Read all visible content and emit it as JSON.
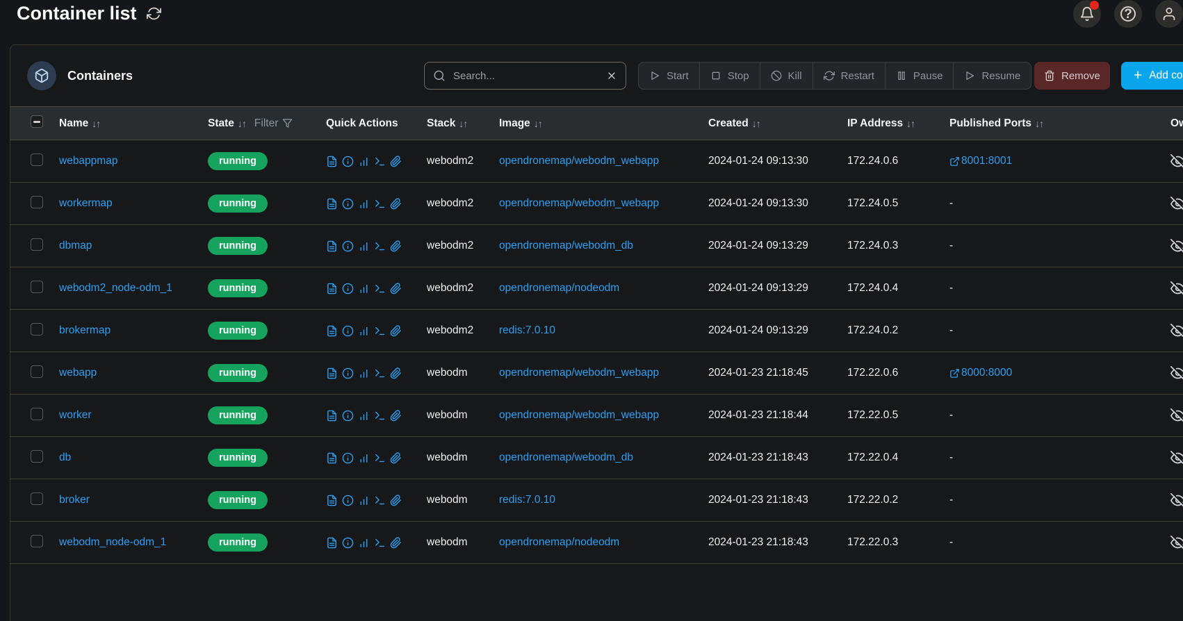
{
  "page_title": "Container list",
  "topbar": {
    "icons": [
      "notifications-bell",
      "help",
      "user"
    ]
  },
  "widget": {
    "title": "Containers",
    "search": {
      "placeholder": "Search..."
    },
    "actions": {
      "start": "Start",
      "stop": "Stop",
      "kill": "Kill",
      "restart": "Restart",
      "pause": "Pause",
      "resume": "Resume",
      "remove": "Remove",
      "add_plus": "+",
      "add": "Add container"
    }
  },
  "table": {
    "sort_glyph": "↓↑",
    "headers": {
      "name": "Name",
      "state": "State",
      "state_filter": "Filter",
      "quick_actions": "Quick Actions",
      "stack": "Stack",
      "image": "Image",
      "created": "Created",
      "ip": "IP Address",
      "ports": "Published Ports",
      "ownership": "Ownership"
    },
    "ports_empty": "-",
    "quick_action_icons": [
      "logs",
      "inspect",
      "stats",
      "exec-console",
      "attach"
    ],
    "rows": [
      {
        "name": "webappmap",
        "state": "running",
        "stack": "webodm2",
        "image": "opendronemap/webodm_webapp",
        "created": "2024-01-24 09:13:30",
        "ip": "172.24.0.6",
        "ports": "8001:8001"
      },
      {
        "name": "workermap",
        "state": "running",
        "stack": "webodm2",
        "image": "opendronemap/webodm_webapp",
        "created": "2024-01-24 09:13:30",
        "ip": "172.24.0.5",
        "ports": ""
      },
      {
        "name": "dbmap",
        "state": "running",
        "stack": "webodm2",
        "image": "opendronemap/webodm_db",
        "created": "2024-01-24 09:13:29",
        "ip": "172.24.0.3",
        "ports": ""
      },
      {
        "name": "webodm2_node-odm_1",
        "state": "running",
        "stack": "webodm2",
        "image": "opendronemap/nodeodm",
        "created": "2024-01-24 09:13:29",
        "ip": "172.24.0.4",
        "ports": ""
      },
      {
        "name": "brokermap",
        "state": "running",
        "stack": "webodm2",
        "image": "redis:7.0.10",
        "created": "2024-01-24 09:13:29",
        "ip": "172.24.0.2",
        "ports": ""
      },
      {
        "name": "webapp",
        "state": "running",
        "stack": "webodm",
        "image": "opendronemap/webodm_webapp",
        "created": "2024-01-23 21:18:45",
        "ip": "172.22.0.6",
        "ports": "8000:8000"
      },
      {
        "name": "worker",
        "state": "running",
        "stack": "webodm",
        "image": "opendronemap/webodm_webapp",
        "created": "2024-01-23 21:18:44",
        "ip": "172.22.0.5",
        "ports": ""
      },
      {
        "name": "db",
        "state": "running",
        "stack": "webodm",
        "image": "opendronemap/webodm_db",
        "created": "2024-01-23 21:18:43",
        "ip": "172.22.0.4",
        "ports": ""
      },
      {
        "name": "broker",
        "state": "running",
        "stack": "webodm",
        "image": "redis:7.0.10",
        "created": "2024-01-23 21:18:43",
        "ip": "172.22.0.2",
        "ports": ""
      },
      {
        "name": "webodm_node-odm_1",
        "state": "running",
        "stack": "webodm",
        "image": "opendronemap/nodeodm",
        "created": "2024-01-23 21:18:43",
        "ip": "172.22.0.3",
        "ports": ""
      }
    ]
  },
  "colors": {
    "link_blue": "#2f9ff2",
    "running_green": "#15a35e",
    "add_button_blue": "#0ba5ec",
    "remove_button_red": "#5a2729",
    "notification_dot_red": "#e2261b"
  }
}
